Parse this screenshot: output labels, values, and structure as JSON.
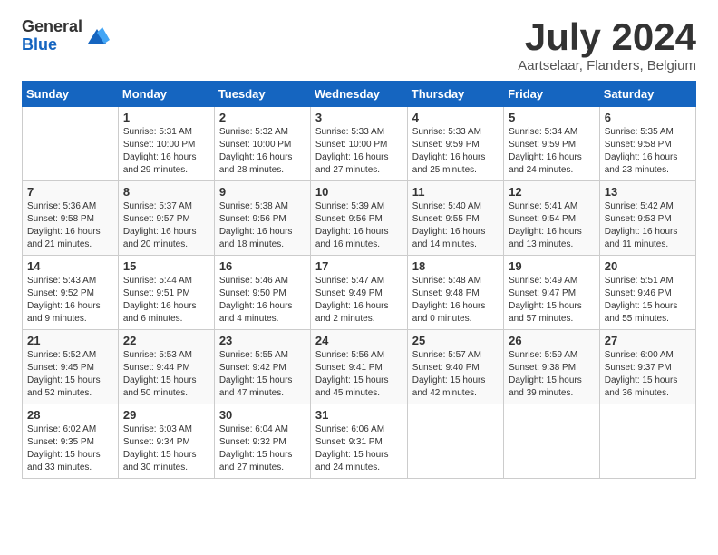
{
  "logo": {
    "general": "General",
    "blue": "Blue"
  },
  "title": "July 2024",
  "location": "Aartselaar, Flanders, Belgium",
  "weekdays": [
    "Sunday",
    "Monday",
    "Tuesday",
    "Wednesday",
    "Thursday",
    "Friday",
    "Saturday"
  ],
  "weeks": [
    [
      {
        "day": "",
        "info": ""
      },
      {
        "day": "1",
        "info": "Sunrise: 5:31 AM\nSunset: 10:00 PM\nDaylight: 16 hours\nand 29 minutes."
      },
      {
        "day": "2",
        "info": "Sunrise: 5:32 AM\nSunset: 10:00 PM\nDaylight: 16 hours\nand 28 minutes."
      },
      {
        "day": "3",
        "info": "Sunrise: 5:33 AM\nSunset: 10:00 PM\nDaylight: 16 hours\nand 27 minutes."
      },
      {
        "day": "4",
        "info": "Sunrise: 5:33 AM\nSunset: 9:59 PM\nDaylight: 16 hours\nand 25 minutes."
      },
      {
        "day": "5",
        "info": "Sunrise: 5:34 AM\nSunset: 9:59 PM\nDaylight: 16 hours\nand 24 minutes."
      },
      {
        "day": "6",
        "info": "Sunrise: 5:35 AM\nSunset: 9:58 PM\nDaylight: 16 hours\nand 23 minutes."
      }
    ],
    [
      {
        "day": "7",
        "info": "Sunrise: 5:36 AM\nSunset: 9:58 PM\nDaylight: 16 hours\nand 21 minutes."
      },
      {
        "day": "8",
        "info": "Sunrise: 5:37 AM\nSunset: 9:57 PM\nDaylight: 16 hours\nand 20 minutes."
      },
      {
        "day": "9",
        "info": "Sunrise: 5:38 AM\nSunset: 9:56 PM\nDaylight: 16 hours\nand 18 minutes."
      },
      {
        "day": "10",
        "info": "Sunrise: 5:39 AM\nSunset: 9:56 PM\nDaylight: 16 hours\nand 16 minutes."
      },
      {
        "day": "11",
        "info": "Sunrise: 5:40 AM\nSunset: 9:55 PM\nDaylight: 16 hours\nand 14 minutes."
      },
      {
        "day": "12",
        "info": "Sunrise: 5:41 AM\nSunset: 9:54 PM\nDaylight: 16 hours\nand 13 minutes."
      },
      {
        "day": "13",
        "info": "Sunrise: 5:42 AM\nSunset: 9:53 PM\nDaylight: 16 hours\nand 11 minutes."
      }
    ],
    [
      {
        "day": "14",
        "info": "Sunrise: 5:43 AM\nSunset: 9:52 PM\nDaylight: 16 hours\nand 9 minutes."
      },
      {
        "day": "15",
        "info": "Sunrise: 5:44 AM\nSunset: 9:51 PM\nDaylight: 16 hours\nand 6 minutes."
      },
      {
        "day": "16",
        "info": "Sunrise: 5:46 AM\nSunset: 9:50 PM\nDaylight: 16 hours\nand 4 minutes."
      },
      {
        "day": "17",
        "info": "Sunrise: 5:47 AM\nSunset: 9:49 PM\nDaylight: 16 hours\nand 2 minutes."
      },
      {
        "day": "18",
        "info": "Sunrise: 5:48 AM\nSunset: 9:48 PM\nDaylight: 16 hours\nand 0 minutes."
      },
      {
        "day": "19",
        "info": "Sunrise: 5:49 AM\nSunset: 9:47 PM\nDaylight: 15 hours\nand 57 minutes."
      },
      {
        "day": "20",
        "info": "Sunrise: 5:51 AM\nSunset: 9:46 PM\nDaylight: 15 hours\nand 55 minutes."
      }
    ],
    [
      {
        "day": "21",
        "info": "Sunrise: 5:52 AM\nSunset: 9:45 PM\nDaylight: 15 hours\nand 52 minutes."
      },
      {
        "day": "22",
        "info": "Sunrise: 5:53 AM\nSunset: 9:44 PM\nDaylight: 15 hours\nand 50 minutes."
      },
      {
        "day": "23",
        "info": "Sunrise: 5:55 AM\nSunset: 9:42 PM\nDaylight: 15 hours\nand 47 minutes."
      },
      {
        "day": "24",
        "info": "Sunrise: 5:56 AM\nSunset: 9:41 PM\nDaylight: 15 hours\nand 45 minutes."
      },
      {
        "day": "25",
        "info": "Sunrise: 5:57 AM\nSunset: 9:40 PM\nDaylight: 15 hours\nand 42 minutes."
      },
      {
        "day": "26",
        "info": "Sunrise: 5:59 AM\nSunset: 9:38 PM\nDaylight: 15 hours\nand 39 minutes."
      },
      {
        "day": "27",
        "info": "Sunrise: 6:00 AM\nSunset: 9:37 PM\nDaylight: 15 hours\nand 36 minutes."
      }
    ],
    [
      {
        "day": "28",
        "info": "Sunrise: 6:02 AM\nSunset: 9:35 PM\nDaylight: 15 hours\nand 33 minutes."
      },
      {
        "day": "29",
        "info": "Sunrise: 6:03 AM\nSunset: 9:34 PM\nDaylight: 15 hours\nand 30 minutes."
      },
      {
        "day": "30",
        "info": "Sunrise: 6:04 AM\nSunset: 9:32 PM\nDaylight: 15 hours\nand 27 minutes."
      },
      {
        "day": "31",
        "info": "Sunrise: 6:06 AM\nSunset: 9:31 PM\nDaylight: 15 hours\nand 24 minutes."
      },
      {
        "day": "",
        "info": ""
      },
      {
        "day": "",
        "info": ""
      },
      {
        "day": "",
        "info": ""
      }
    ]
  ]
}
